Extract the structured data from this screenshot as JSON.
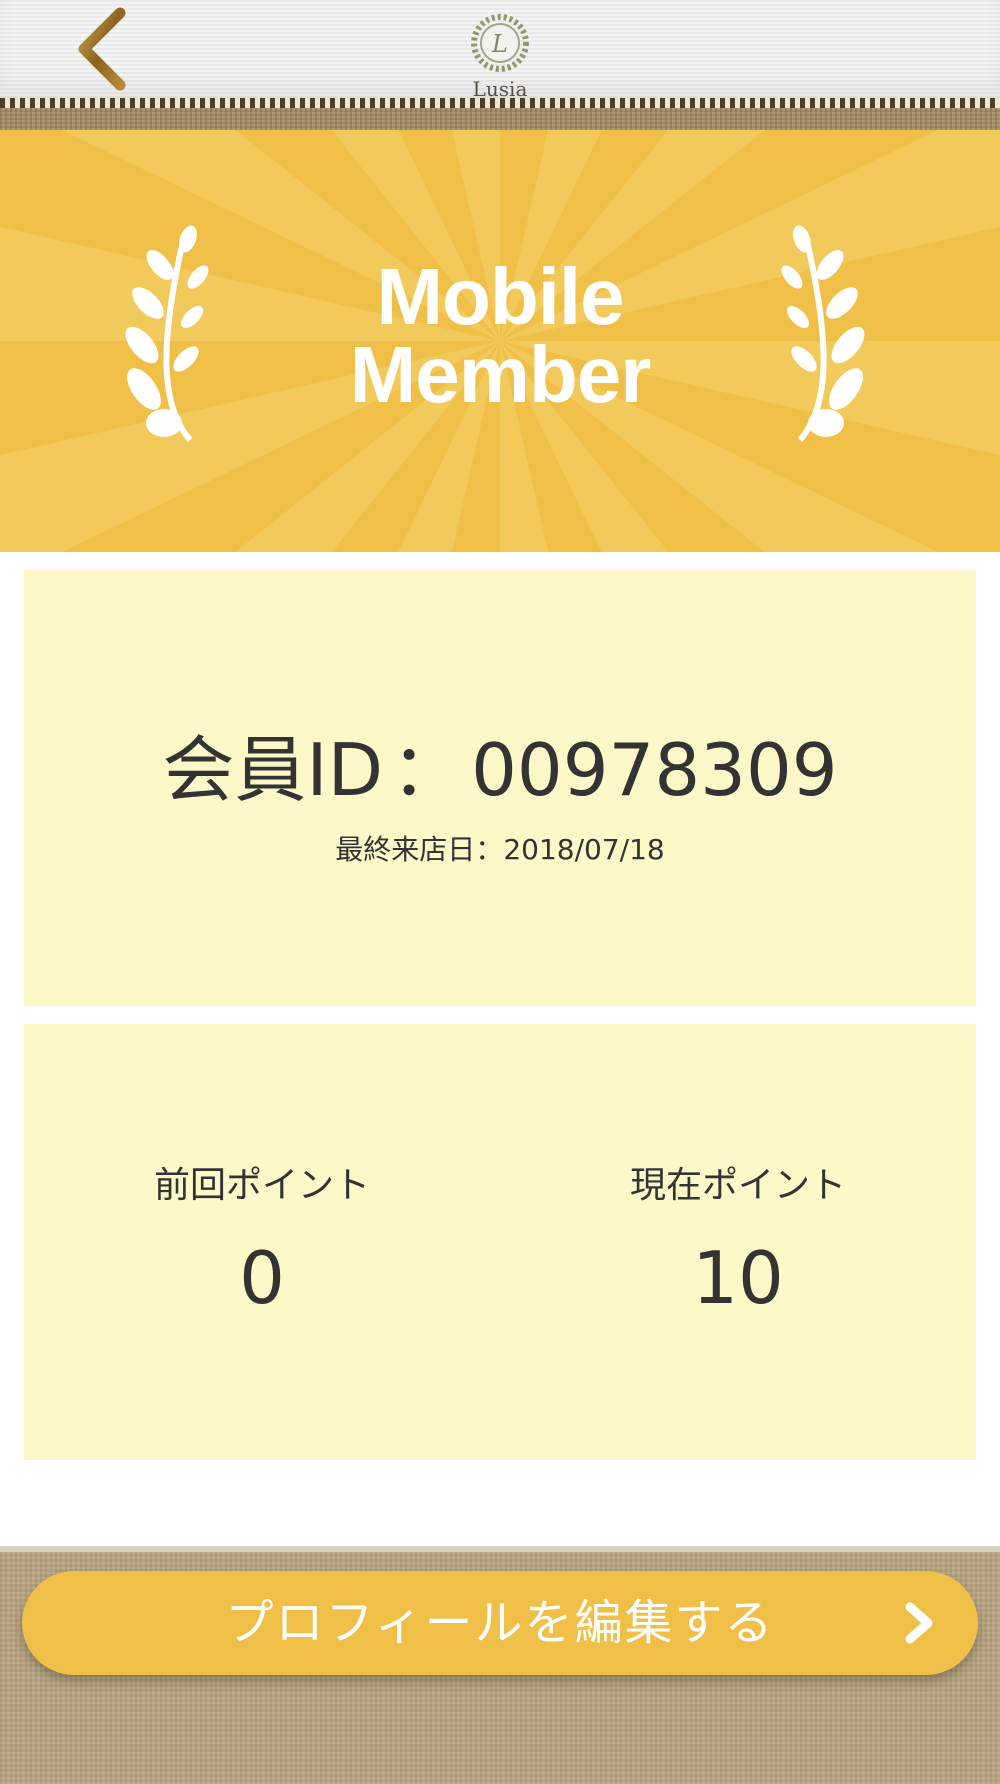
{
  "header": {
    "back_icon": "chevron-left-icon",
    "logo_name": "Lusia",
    "logo_icon": "wreath-logo-icon"
  },
  "hero": {
    "title_line1": "Mobile",
    "title_line2": "Member",
    "background_color": "#f0bf47",
    "decoration_icon": "laurel-branch-icon"
  },
  "member": {
    "id_label": "会員ID",
    "id_separator": "：",
    "id_value": "00978309",
    "last_visit_label": "最終来店日：",
    "last_visit_value": "2018/07/18"
  },
  "points": {
    "previous_label": "前回ポイント",
    "previous_value": "0",
    "current_label": "現在ポイント",
    "current_value": "10"
  },
  "footer": {
    "edit_button_label": "プロフィールを編集する",
    "edit_button_icon": "chevron-right-icon",
    "button_color": "#f0bf47"
  },
  "colors": {
    "card_background": "#fcf8c8",
    "text": "#333333",
    "accent": "#f0bf47"
  }
}
